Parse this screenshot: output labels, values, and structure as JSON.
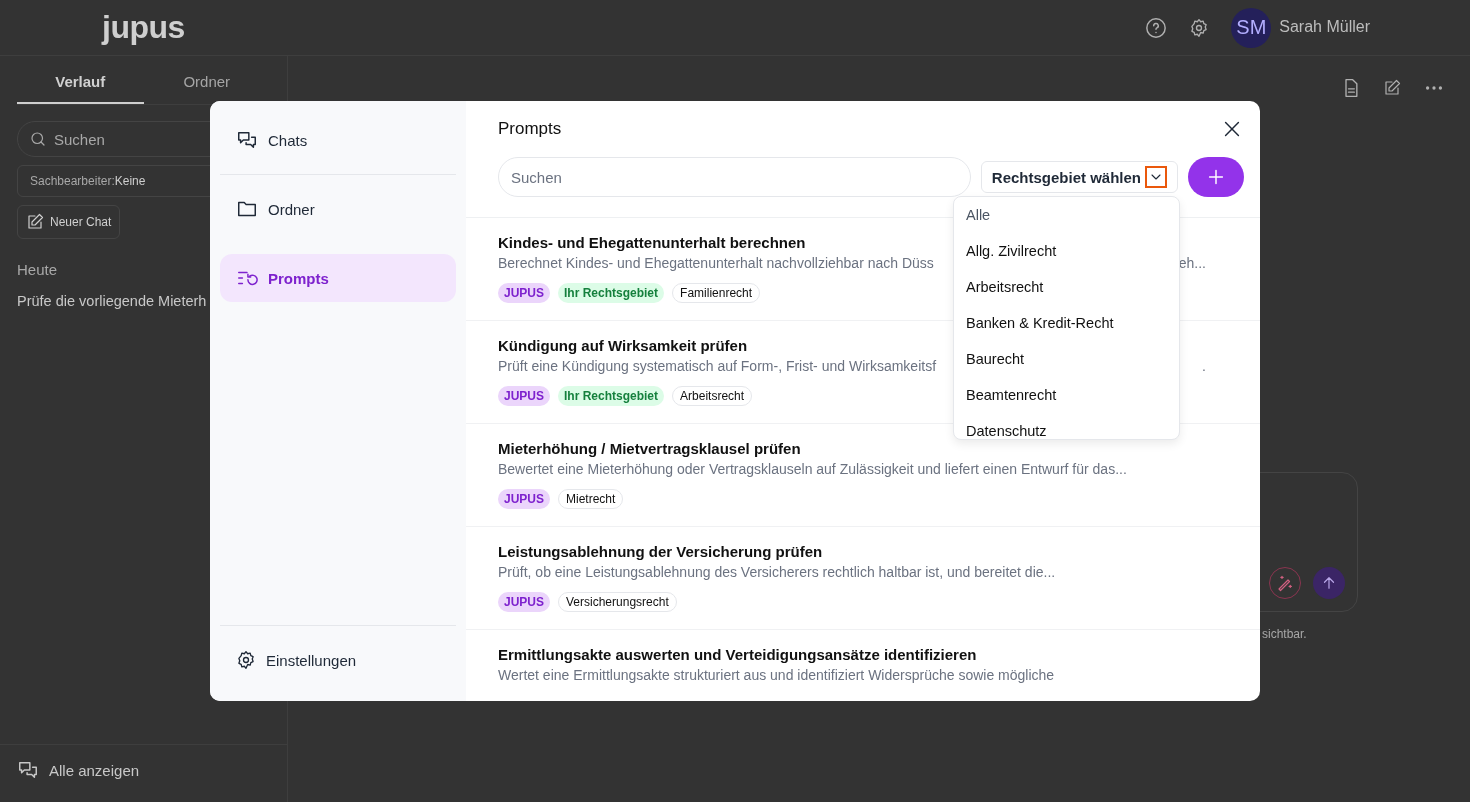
{
  "app": {
    "logo": "jupus",
    "user": {
      "initials": "SM",
      "name": "Sarah Müller"
    },
    "sidebar": {
      "tabs": [
        {
          "label": "Verlauf",
          "selected": true
        },
        {
          "label": "Ordner",
          "selected": false
        }
      ],
      "search": {
        "placeholder": "Suchen"
      },
      "filter": {
        "label": "Sachbearbeiter:",
        "value": "Keine"
      },
      "new_chat": "Neuer Chat",
      "group": "Heute",
      "chats": [
        "Prüfe die vorliegende Mieterh"
      ],
      "show_all": "Alle anzeigen"
    },
    "footer_note": "sichtbar."
  },
  "modal": {
    "nav": [
      {
        "label": "Chats",
        "selected": false
      },
      {
        "label": "Ordner",
        "selected": false
      },
      {
        "label": "Prompts",
        "selected": true
      }
    ],
    "settings": "Einstellungen",
    "title": "Prompts",
    "search": {
      "placeholder": "Suchen"
    },
    "area_select": "Rechtsgebiet wählen",
    "dropdown": [
      "Alle",
      "Allg. Zivilrecht",
      "Arbeitsrecht",
      "Banken & Kredit-Recht",
      "Baurecht",
      "Beamtenrecht",
      "Datenschutz"
    ],
    "prompts": [
      {
        "title": "Kindes- und Ehegattenunterhalt berechnen",
        "desc": "Berechnet Kindes- und Ehegattenunterhalt nachvollziehbar nach Düss",
        "desc_tail": "eh...",
        "tags": [
          {
            "kind": "jupus",
            "label": "JUPUS"
          },
          {
            "kind": "own",
            "label": "Ihr Rechtsgebiet"
          },
          {
            "kind": "area",
            "label": "Familienrecht"
          }
        ]
      },
      {
        "title": "Kündigung auf Wirksamkeit prüfen",
        "desc": "Prüft eine Kündigung systematisch auf Form-, Frist- und Wirksamkeitsf",
        "desc_tail": ".",
        "tags": [
          {
            "kind": "jupus",
            "label": "JUPUS"
          },
          {
            "kind": "own",
            "label": "Ihr Rechtsgebiet"
          },
          {
            "kind": "area",
            "label": "Arbeitsrecht"
          }
        ]
      },
      {
        "title": "Mieterhöhung / Mietvertragsklausel prüfen",
        "desc": "Bewertet eine Mieterhöhung oder Vertragsklauseln auf Zulässigkeit und liefert einen Entwurf für das...",
        "tags": [
          {
            "kind": "jupus",
            "label": "JUPUS"
          },
          {
            "kind": "area",
            "label": "Mietrecht"
          }
        ]
      },
      {
        "title": "Leistungsablehnung der Versicherung prüfen",
        "desc": "Prüft, ob eine Leistungsablehnung des Versicherers rechtlich haltbar ist, und bereitet die...",
        "tags": [
          {
            "kind": "jupus",
            "label": "JUPUS"
          },
          {
            "kind": "area",
            "label": "Versicherungsrecht"
          }
        ]
      },
      {
        "title": "Ermittlungsakte auswerten und Verteidigungsansätze identifizieren",
        "desc": "Wertet eine Ermittlungsakte strukturiert aus und identifiziert Widersprüche sowie mögliche"
      }
    ]
  }
}
